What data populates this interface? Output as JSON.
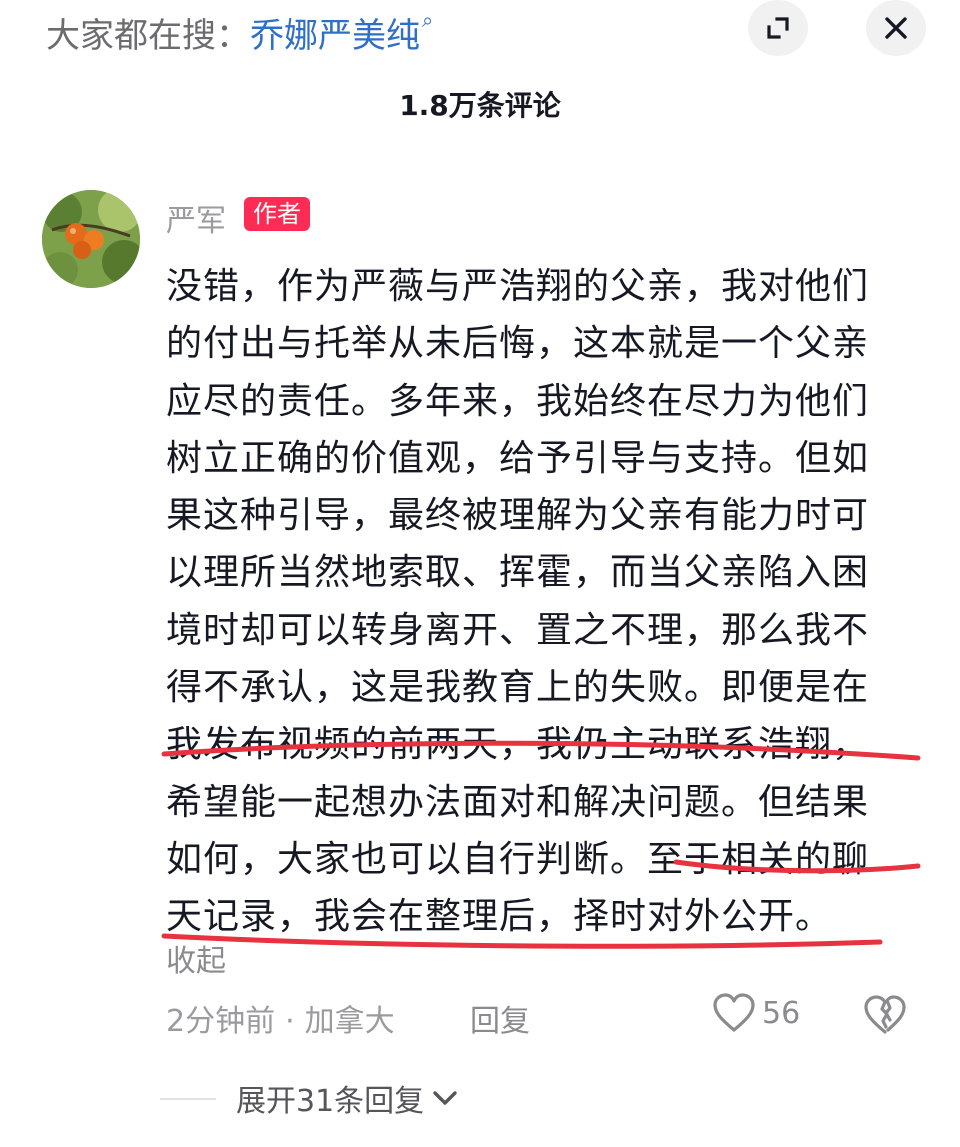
{
  "search": {
    "prefix": "大家都在搜：",
    "term": "乔娜严美纯",
    "search_glyph": "⌕"
  },
  "header": {
    "comment_count": "1.8万条评论"
  },
  "comment": {
    "author": "严军",
    "author_tag": "作者",
    "lines": [
      "没错，作为严薇与严浩翔的父亲，我对他们",
      "的付出与托举从未后悔，这本就是一个父亲",
      "应尽的责任。多年来，我始终在尽力为他们",
      "树立正确的价值观，给予引导与支持。但如",
      "果这种引导，最终被理解为父亲有能力时可",
      "以理所当然地索取、挥霍，而当父亲陷入困",
      "境时却可以转身离开、置之不理，那么我不",
      "得不承认，这是我教育上的失败。即便是在",
      "我发布视频的前两天，我仍主动联系浩翔，",
      "希望能一起想办法面对和解决问题。但结果",
      "如何，大家也可以自行判断。至于相关的聊",
      "天记录，我会在整理后，择时对外公开。"
    ],
    "collapse_label": "收起",
    "time": "2分钟前",
    "separator": "·",
    "location": "加拿大",
    "reply_label": "回复",
    "like_count": "56"
  },
  "replies": {
    "expand_label": "展开31条回复"
  },
  "colors": {
    "accent_link": "#2e6fc7",
    "author_tag_bg": "#fe2c55",
    "annotation_red": "#e8323f"
  },
  "icons": [
    "expand-icon",
    "close-icon",
    "heart-icon",
    "broken-heart-icon",
    "chevron-down-icon"
  ]
}
